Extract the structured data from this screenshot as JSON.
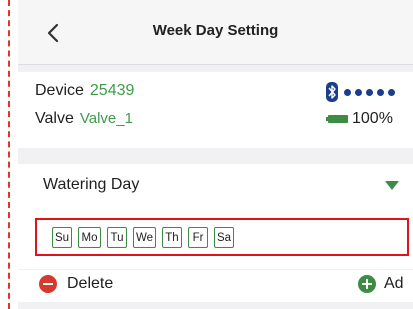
{
  "header": {
    "title": "Week Day Setting",
    "back_icon": "chevron-left-icon"
  },
  "device": {
    "device_label": "Device",
    "device_id": "25439",
    "valve_label": "Valve",
    "valve_name": "Valve_1",
    "bluetooth_icon": "bluetooth-icon",
    "signal_dots": 5,
    "battery_icon": "battery-icon",
    "battery_text": "100%"
  },
  "watering": {
    "label": "Watering Day",
    "dropdown_icon": "triangle-down-icon",
    "days": [
      "Su",
      "Mo",
      "Tu",
      "We",
      "Th",
      "Fr",
      "Sa"
    ]
  },
  "actions": {
    "delete_label": "Delete",
    "add_label": "Ad",
    "delete_icon": "minus-circle-icon",
    "add_icon": "plus-circle-icon"
  },
  "colors": {
    "accent_green": "#3c8c44",
    "value_green": "#3f9b4a",
    "highlight_red": "#e0131c",
    "delete_red": "#d63a2e",
    "signal_blue": "#1a3e8c"
  }
}
